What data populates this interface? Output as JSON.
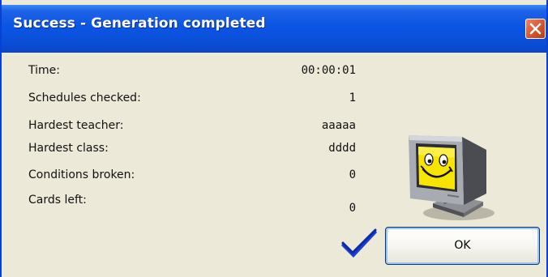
{
  "dialog": {
    "title": "Success - Generation completed",
    "stats": [
      {
        "label": "Time:",
        "value": "00:00:01"
      },
      {
        "label": "Schedules checked:",
        "value": "1"
      },
      {
        "label": "Hardest teacher:",
        "value": "aaaaa"
      },
      {
        "label": "Hardest class:",
        "value": "dddd"
      },
      {
        "label": "Conditions broken:",
        "value": "0"
      },
      {
        "label": "Cards left:",
        "value": "0"
      }
    ],
    "ok_label": "OK"
  },
  "icons": {
    "close": "close-icon",
    "illustration": "smiling-monitor-icon",
    "status": "checkmark-icon"
  },
  "colors": {
    "titlebar": "#0a4fd9",
    "close_button": "#d9542c",
    "client_background": "#ece9d8",
    "checkmark": "#1a3fd0",
    "face": "#f7e400"
  }
}
